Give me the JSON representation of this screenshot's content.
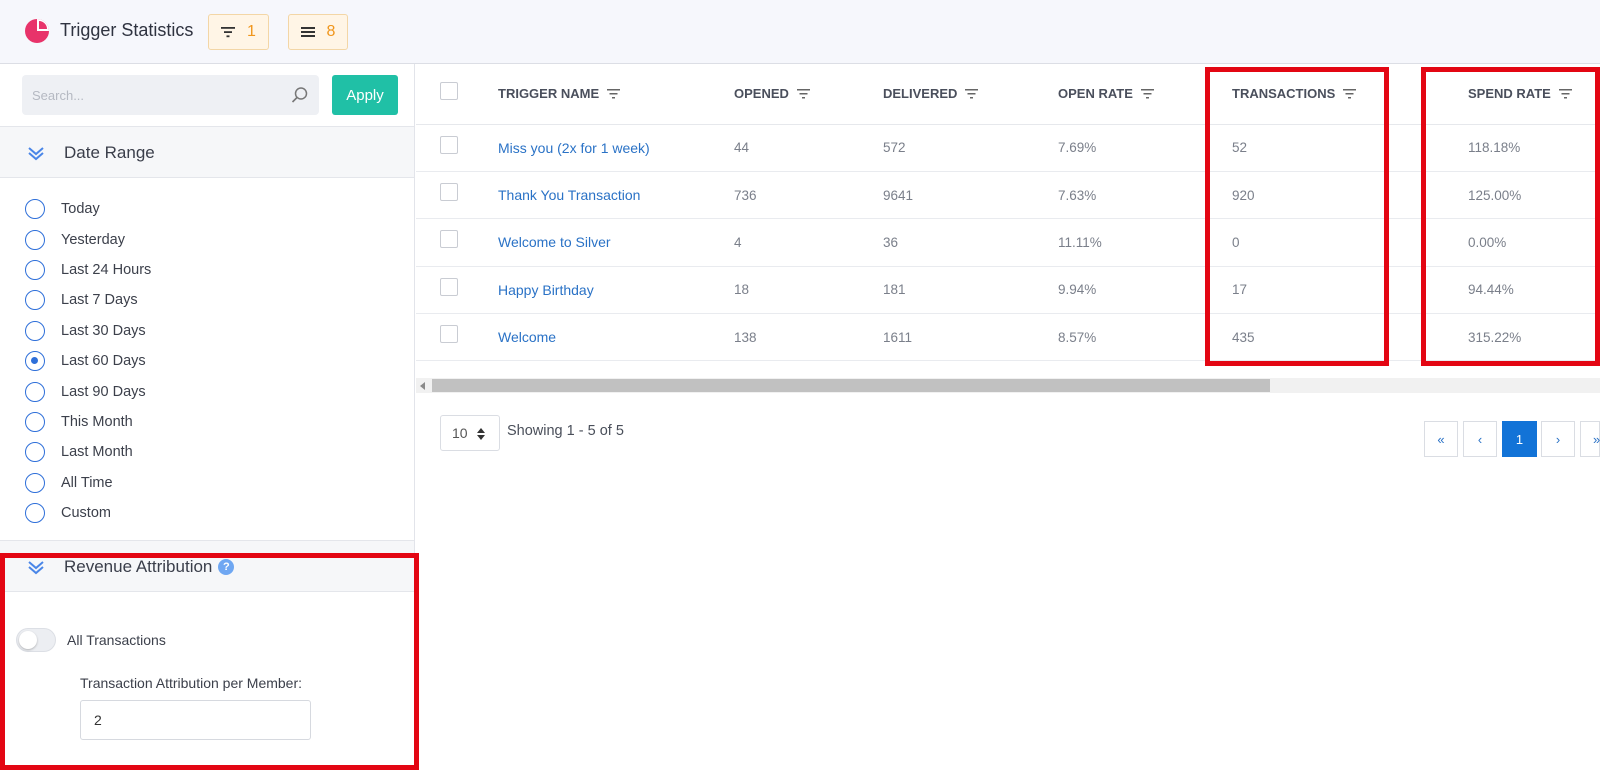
{
  "header": {
    "title": "Trigger Statistics",
    "filter_badge_count": "1",
    "list_badge_count": "8",
    "brand_color": "#e8336a"
  },
  "sidebar": {
    "search": {
      "placeholder": "Search...",
      "value": ""
    },
    "apply_label": "Apply",
    "date_range": {
      "title": "Date Range",
      "options": [
        {
          "label": "Today",
          "checked": false
        },
        {
          "label": "Yesterday",
          "checked": false
        },
        {
          "label": "Last 24 Hours",
          "checked": false
        },
        {
          "label": "Last 7 Days",
          "checked": false
        },
        {
          "label": "Last 30 Days",
          "checked": false
        },
        {
          "label": "Last 60 Days",
          "checked": true
        },
        {
          "label": "Last 90 Days",
          "checked": false
        },
        {
          "label": "This Month",
          "checked": false
        },
        {
          "label": "Last Month",
          "checked": false
        },
        {
          "label": "All Time",
          "checked": false
        },
        {
          "label": "Custom",
          "checked": false
        }
      ]
    },
    "revenue": {
      "title": "Revenue Attribution",
      "help": "?",
      "toggle_label": "All Transactions",
      "toggle_on": false,
      "attribution_label": "Transaction Attribution per Member:",
      "attribution_value": "2"
    }
  },
  "table": {
    "columns": {
      "name": "TRIGGER NAME",
      "opened": "OPENED",
      "delivered": "DELIVERED",
      "open_rate": "OPEN RATE",
      "transactions": "TRANSACTIONS",
      "spend_rate": "SPEND RATE"
    },
    "rows": [
      {
        "name": "Miss you (2x for 1 week)",
        "opened": "44",
        "delivered": "572",
        "open_rate": "7.69%",
        "transactions": "52",
        "spend_rate": "118.18%"
      },
      {
        "name": "Thank You Transaction",
        "opened": "736",
        "delivered": "9641",
        "open_rate": "7.63%",
        "transactions": "920",
        "spend_rate": "125.00%"
      },
      {
        "name": "Welcome to Silver",
        "opened": "4",
        "delivered": "36",
        "open_rate": "11.11%",
        "transactions": "0",
        "spend_rate": "0.00%"
      },
      {
        "name": "Happy Birthday",
        "opened": "18",
        "delivered": "181",
        "open_rate": "9.94%",
        "transactions": "17",
        "spend_rate": "94.44%"
      },
      {
        "name": "Welcome",
        "opened": "138",
        "delivered": "1611",
        "open_rate": "8.57%",
        "transactions": "435",
        "spend_rate": "315.22%"
      }
    ]
  },
  "pagination": {
    "page_size": "10",
    "showing": "Showing 1 - 5 of 5",
    "first": "«",
    "prev": "‹",
    "current": "1",
    "next": "›",
    "last": "»"
  }
}
